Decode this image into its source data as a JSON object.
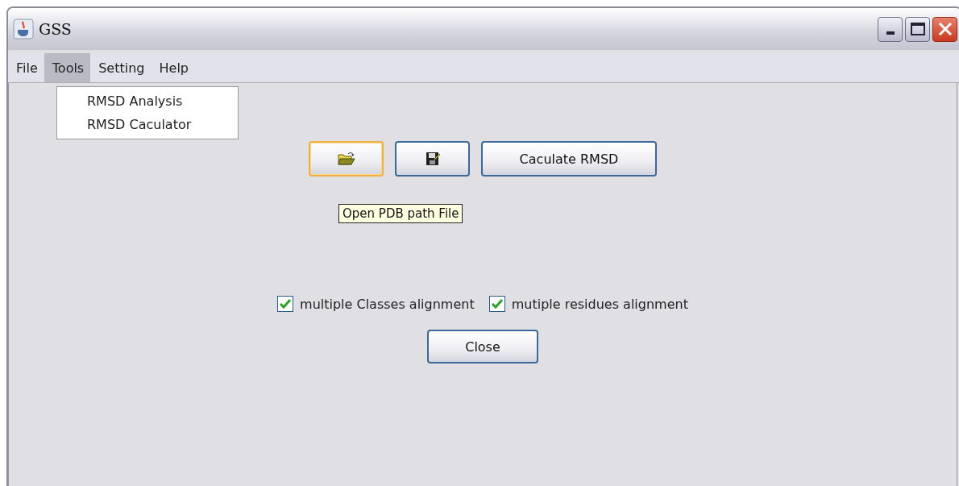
{
  "window": {
    "title": "GSS"
  },
  "menu_bar": [
    {
      "label": "File",
      "selected": false
    },
    {
      "label": "Tools",
      "selected": true
    },
    {
      "label": "Setting",
      "selected": false
    },
    {
      "label": "Help",
      "selected": false
    }
  ],
  "open_menu": {
    "items": [
      "RMSD Analysis",
      "RMSD Caculator"
    ]
  },
  "toolbar": [
    {
      "kind": "open",
      "highlighted": true
    },
    {
      "kind": "save",
      "highlighted": false
    },
    {
      "kind": "text",
      "label": "Caculate RMSD",
      "highlighted": false
    }
  ],
  "tooltip": "Open PDB path File",
  "options": [
    {
      "label": "multiple Classes alignment",
      "checked": true
    },
    {
      "label": "mutiple residues alignment",
      "checked": true
    }
  ],
  "close_button": {
    "label": "Close"
  }
}
